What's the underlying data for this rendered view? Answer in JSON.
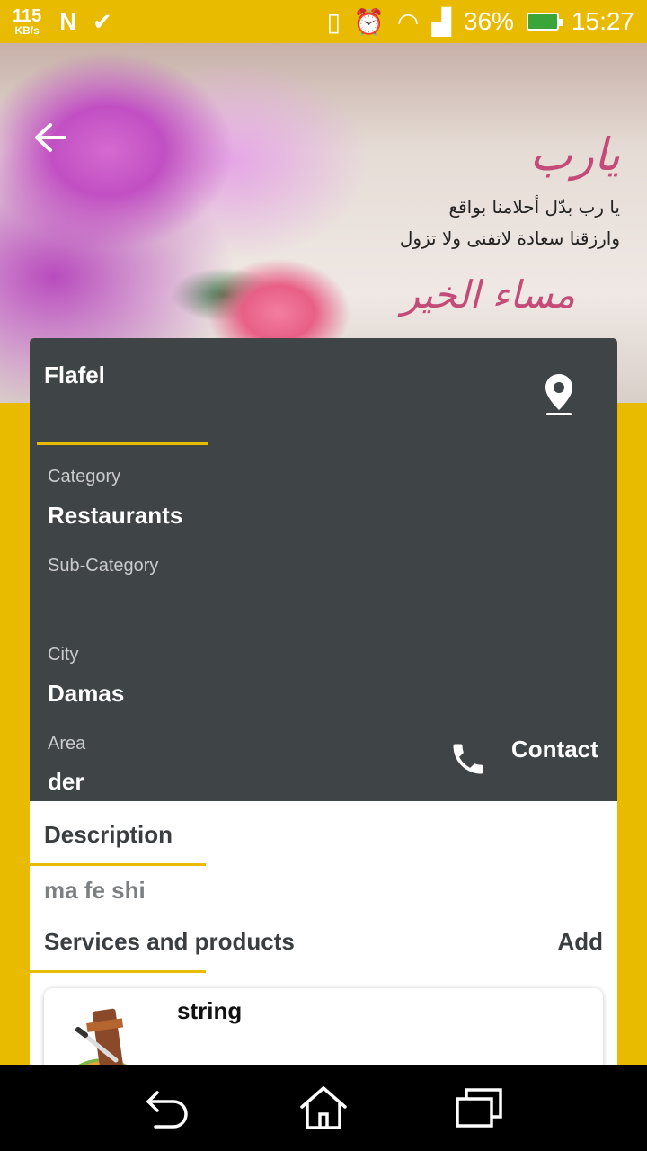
{
  "status_bar": {
    "net_speed": "115",
    "net_unit": "KB/s",
    "battery": "36%",
    "time": "15:27",
    "icons": [
      "n-icon",
      "check-icon",
      "vibrate-icon",
      "alarm-icon",
      "wifi-icon",
      "signal-icon",
      "battery-charging-icon"
    ]
  },
  "hero": {
    "arabic_title": "يارب",
    "arabic_line1": "يا رب بدّل أحلامنا بواقع",
    "arabic_line2": "وارزقنا سعادة لاتفنى ولا تزول",
    "arabic_signature": "مساء الخير"
  },
  "details": {
    "name": "Flafel",
    "category_label": "Category",
    "category": "Restaurants",
    "subcategory_label": "Sub-Category",
    "subcategory": "",
    "city_label": "City",
    "city": "Damas",
    "area_label": "Area",
    "area": "der",
    "contact_label": "Contact"
  },
  "description": {
    "heading": "Description",
    "text": "ma fe shi"
  },
  "services": {
    "heading": "Services and products",
    "add_label": "Add",
    "items": [
      {
        "title": "string"
      }
    ]
  },
  "colors": {
    "accent": "#E9BB00",
    "card_dark": "#3F4447",
    "nav": "#000000"
  }
}
